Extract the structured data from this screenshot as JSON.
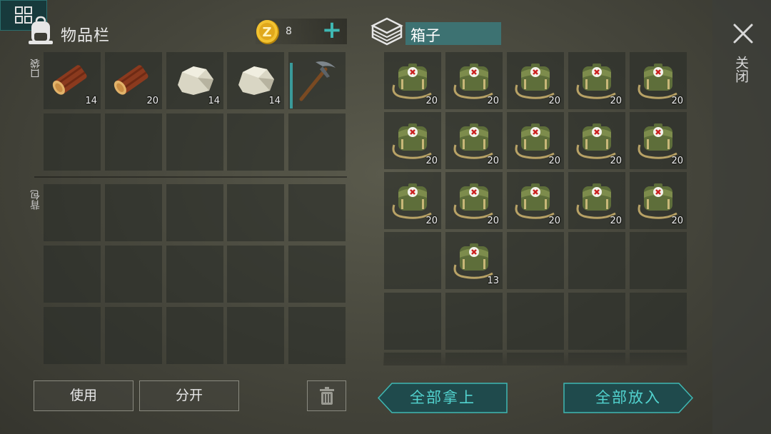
{
  "inventory": {
    "title": "物品栏",
    "pocket_label": "口袋",
    "backpack_label": "背包",
    "coins": "8",
    "hotbar": [
      {
        "item": "log",
        "count": "14"
      },
      {
        "item": "log",
        "count": "20"
      },
      {
        "item": "stone",
        "count": "14"
      },
      {
        "item": "stone",
        "count": "14"
      },
      {
        "item": "pickaxe",
        "count": ""
      }
    ]
  },
  "container": {
    "title": "箱子",
    "slots": [
      {
        "item": "medkit-bag",
        "count": "20"
      },
      {
        "item": "medkit-bag",
        "count": "20"
      },
      {
        "item": "medkit-bag",
        "count": "20"
      },
      {
        "item": "medkit-bag",
        "count": "20"
      },
      {
        "item": "medkit-bag",
        "count": "20"
      },
      {
        "item": "medkit-bag",
        "count": "20"
      },
      {
        "item": "medkit-bag",
        "count": "20"
      },
      {
        "item": "medkit-bag",
        "count": "20"
      },
      {
        "item": "medkit-bag",
        "count": "20"
      },
      {
        "item": "medkit-bag",
        "count": "20"
      },
      {
        "item": "medkit-bag",
        "count": "20"
      },
      {
        "item": "medkit-bag",
        "count": "20"
      },
      {
        "item": "medkit-bag",
        "count": "20"
      },
      {
        "item": "medkit-bag",
        "count": "20"
      },
      {
        "item": "medkit-bag",
        "count": "20"
      },
      {
        "item": "",
        "count": ""
      },
      {
        "item": "medkit-bag",
        "count": "13"
      }
    ]
  },
  "buttons": {
    "use": "使用",
    "split": "分开",
    "take_all": "全部拿上",
    "put_all": "全部放入",
    "close": "关闭"
  },
  "icons": {
    "backpack": "backpack-icon",
    "coin": "coin-icon",
    "add": "plus-icon",
    "container": "crate-icon",
    "close": "close-icon",
    "trash": "trash-icon",
    "sort": "sort-grid-icon"
  },
  "colors": {
    "accent": "#3fb8b3",
    "accent_text": "#52d3cf",
    "title_bar": "#3d7272",
    "slot_bg": "#2a2d29"
  }
}
